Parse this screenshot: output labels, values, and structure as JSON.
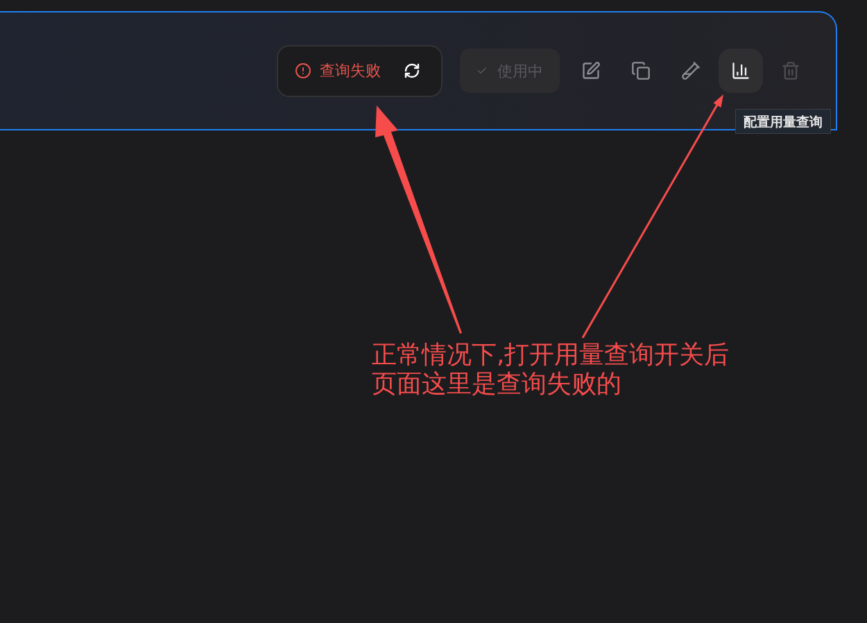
{
  "card": {
    "selected": true
  },
  "status": {
    "kind": "error",
    "label": "查询失败"
  },
  "in_use_button": {
    "label": "使用中",
    "disabled": true
  },
  "actions": [
    {
      "kind": "edit",
      "hovered": false,
      "disabled": false
    },
    {
      "kind": "copy",
      "hovered": false,
      "disabled": false
    },
    {
      "kind": "test",
      "hovered": false,
      "disabled": false
    },
    {
      "kind": "usage",
      "hovered": true,
      "disabled": false
    },
    {
      "kind": "delete",
      "hovered": false,
      "disabled": true
    }
  ],
  "tooltip": {
    "text": "配置用量查询"
  },
  "annotation": {
    "text": "正常情况下,打开用量查询开关后页面这里是查询失败的"
  }
}
